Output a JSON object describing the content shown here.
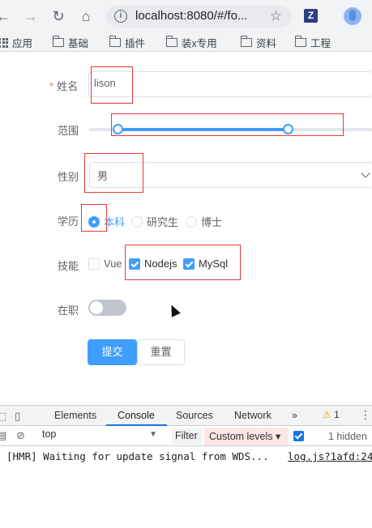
{
  "browser": {
    "url": "localhost:8080/#/fo...",
    "extension_label": "Z",
    "bookmarks": [
      "应用",
      "基础",
      "插件",
      "装x专用",
      "资料",
      "工程"
    ]
  },
  "form": {
    "name_label": "姓名",
    "required_mark": "*",
    "name_value": "lison",
    "range_label": "范围",
    "range_value": [
      10,
      70
    ],
    "gender_label": "性别",
    "gender_value": "男",
    "education_label": "学历",
    "education_options": [
      "本科",
      "研究生",
      "博士"
    ],
    "education_selected": "本科",
    "skills_label": "技能",
    "skills_options": [
      "Vue",
      "Nodejs",
      "MySql"
    ],
    "skills_checked": [
      "Nodejs",
      "MySql"
    ],
    "employed_label": "在职",
    "employed_value": false,
    "submit_label": "提交",
    "reset_label": "重置"
  },
  "devtools": {
    "tabs": [
      "Elements",
      "Console",
      "Sources",
      "Network"
    ],
    "active_tab": "Console",
    "more_tabs": "»",
    "warning_count": "1",
    "context": "top",
    "filter_label": "Filter",
    "levels_label": "Custom levels",
    "hidden_text": "1 hidden",
    "log_message": "[HMR] Waiting for update signal from WDS...",
    "log_source": "log.js?1afd:24"
  },
  "colors": {
    "primary": "#409eff",
    "annotation_red": "#e53935",
    "required": "#f56c6c"
  }
}
